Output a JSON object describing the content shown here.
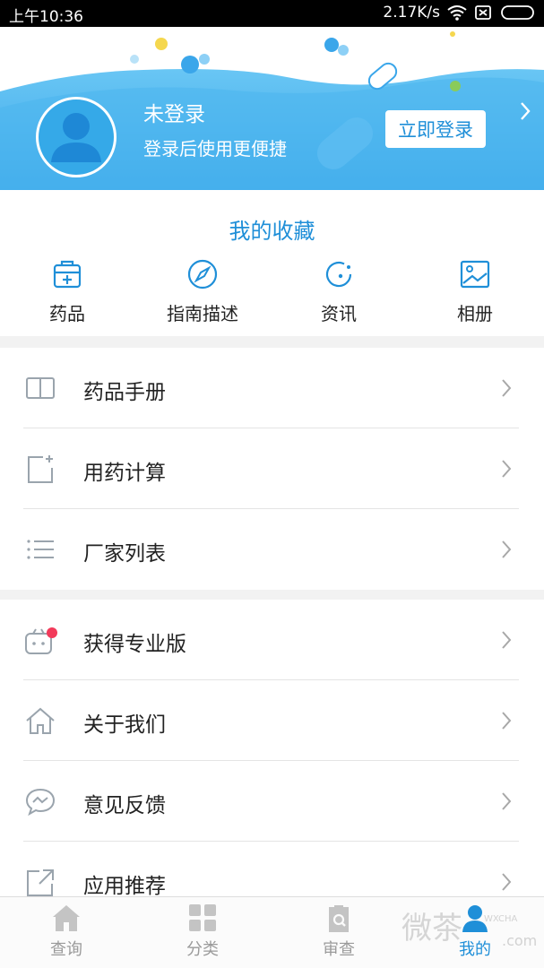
{
  "status_bar": {
    "time": "上午10:36",
    "speed": "2.17K/s"
  },
  "header": {
    "title": "未登录",
    "subtitle": "登录后使用更便捷",
    "login_button": "立即登录"
  },
  "favorites": {
    "title": "我的收藏",
    "items": [
      {
        "label": "药品",
        "icon": "medicine-box-icon"
      },
      {
        "label": "指南描述",
        "icon": "compass-icon"
      },
      {
        "label": "资讯",
        "icon": "news-icon"
      },
      {
        "label": "相册",
        "icon": "photo-album-icon"
      }
    ]
  },
  "menu_group_1": [
    {
      "label": "药品手册",
      "icon": "book-icon"
    },
    {
      "label": "用药计算",
      "icon": "calculator-icon"
    },
    {
      "label": "厂家列表",
      "icon": "list-icon"
    }
  ],
  "menu_group_2": [
    {
      "label": "获得专业版",
      "icon": "bag-icon",
      "badge_color": "#f23a5a"
    },
    {
      "label": "关于我们",
      "icon": "home-outline-icon"
    },
    {
      "label": "意见反馈",
      "icon": "chat-icon"
    },
    {
      "label": "应用推荐",
      "icon": "share-icon"
    }
  ],
  "tabbar": [
    {
      "label": "查询",
      "icon": "home-icon",
      "active": false
    },
    {
      "label": "分类",
      "icon": "grid-icon",
      "active": false
    },
    {
      "label": "审查",
      "icon": "clipboard-icon",
      "active": false
    },
    {
      "label": "我的",
      "icon": "profile-icon",
      "active": true
    }
  ],
  "watermark": {
    "main": "微茶",
    "small": "WXCHA",
    "domain": ".com"
  },
  "colors": {
    "accent": "#1f8fd8",
    "banner": "#4db8f0",
    "badge": "#f23a5a"
  }
}
